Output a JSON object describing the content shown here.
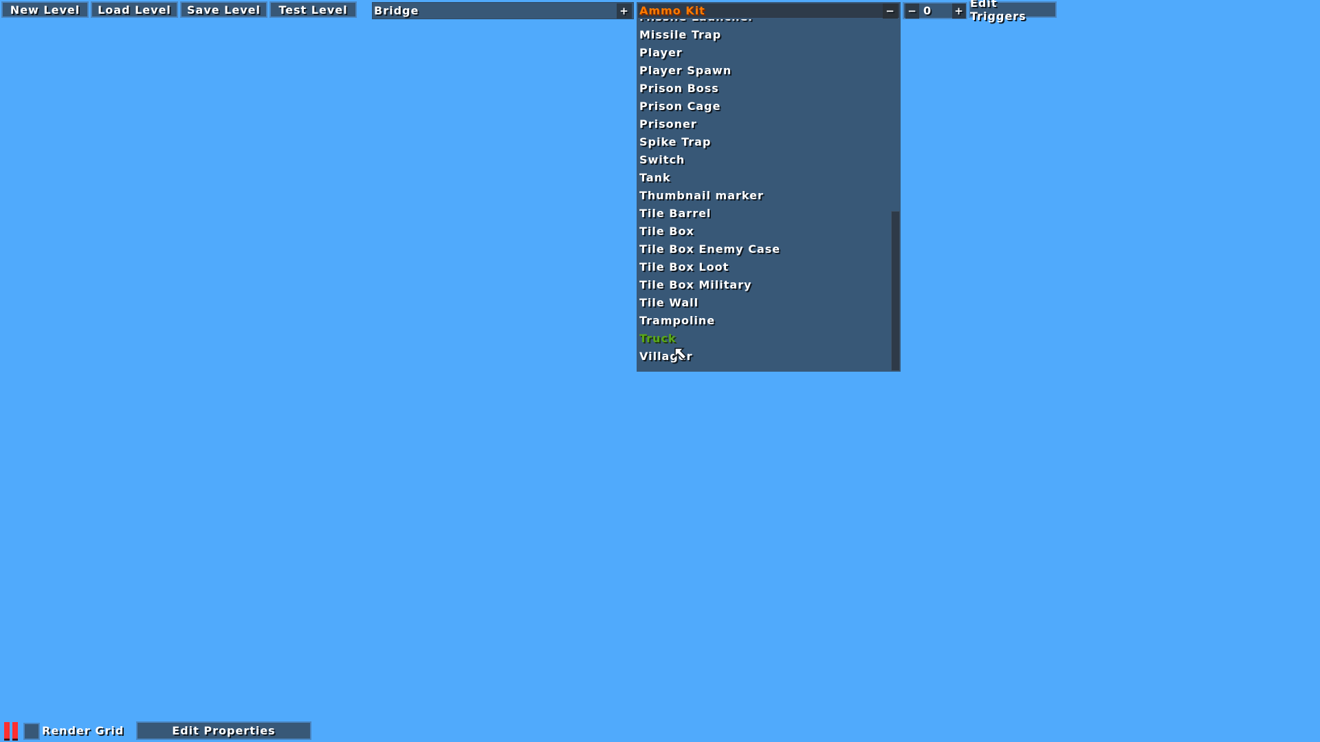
{
  "toolbar": {
    "new_level": "New Level",
    "load_level": "Load Level",
    "save_level": "Save Level",
    "test_level": "Test Level"
  },
  "level_selector": {
    "value": "Bridge",
    "add_symbol": "+"
  },
  "entity_selector": {
    "value": "Ammo Kit",
    "value_color": "#ff7a00",
    "collapse_symbol": "−",
    "items": [
      {
        "label": "Missile Launcher",
        "selected": false
      },
      {
        "label": "Missile Trap",
        "selected": false
      },
      {
        "label": "Player",
        "selected": false
      },
      {
        "label": "Player Spawn",
        "selected": false
      },
      {
        "label": "Prison Boss",
        "selected": false
      },
      {
        "label": "Prison Cage",
        "selected": false
      },
      {
        "label": "Prisoner",
        "selected": false
      },
      {
        "label": "Spike Trap",
        "selected": false
      },
      {
        "label": "Switch",
        "selected": false
      },
      {
        "label": "Tank",
        "selected": false
      },
      {
        "label": "Thumbnail marker",
        "selected": false
      },
      {
        "label": "Tile Barrel",
        "selected": false
      },
      {
        "label": "Tile Box",
        "selected": false
      },
      {
        "label": "Tile Box Enemy Case",
        "selected": false
      },
      {
        "label": "Tile Box Loot",
        "selected": false
      },
      {
        "label": "Tile Box Military",
        "selected": false
      },
      {
        "label": "Tile Wall",
        "selected": false
      },
      {
        "label": "Trampoline",
        "selected": false
      },
      {
        "label": "Truck",
        "selected": true
      },
      {
        "label": "Villager",
        "selected": false
      }
    ],
    "highlight_color": "#5aa818"
  },
  "layer_stepper": {
    "minus": "−",
    "value": "0",
    "plus": "+"
  },
  "edit_triggers": "Edit Triggers",
  "bottom_bar": {
    "render_grid_label": "Render Grid",
    "render_grid_checked": false,
    "edit_properties": "Edit Properties"
  },
  "colors": {
    "background": "#50aafc",
    "panel": "#385877",
    "pause_icon": "#ff3030"
  }
}
